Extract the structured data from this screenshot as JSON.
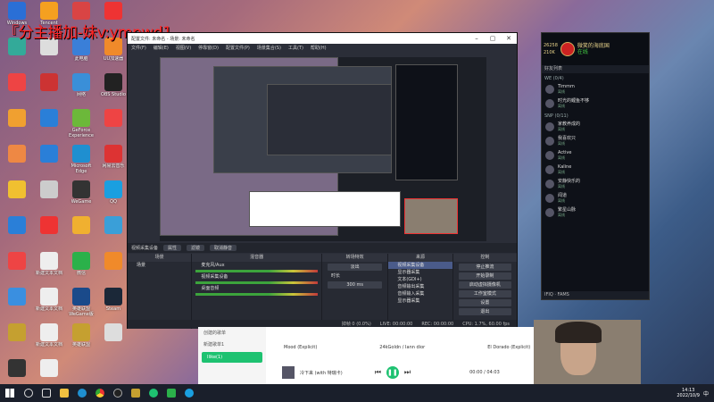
{
  "watermark": "『分主播加-妹v:ympwd1",
  "desktop_icons": [
    {
      "label": "Windows",
      "color": "#2a6fd6"
    },
    {
      "label": "Tencent",
      "color": "#f5a020"
    },
    {
      "label": "",
      "color": "#d94444"
    },
    {
      "label": "",
      "color": "#e33"
    },
    {
      "label": "",
      "color": "#3a9"
    },
    {
      "label": "",
      "color": "#ddd"
    },
    {
      "label": "此电脑",
      "color": "#3a7fd8"
    },
    {
      "label": "UU加速器",
      "color": "#f08a2a"
    },
    {
      "label": "",
      "color": "#e44"
    },
    {
      "label": "",
      "color": "#c33"
    },
    {
      "label": "网络",
      "color": "#3a8fd8"
    },
    {
      "label": "OBS Studio",
      "color": "#222"
    },
    {
      "label": "",
      "color": "#f0a030"
    },
    {
      "label": "",
      "color": "#2a7fd8"
    },
    {
      "label": "GeForce Experience",
      "color": "#6cb83a"
    },
    {
      "label": "",
      "color": "#e44"
    },
    {
      "label": "",
      "color": "#e84"
    },
    {
      "label": "",
      "color": "#2a7fd8"
    },
    {
      "label": "Microsoft Edge",
      "color": "#1f8fd0"
    },
    {
      "label": "网易云音乐",
      "color": "#d33"
    },
    {
      "label": "",
      "color": "#f0c030"
    },
    {
      "label": "",
      "color": "#ccc"
    },
    {
      "label": "WeGame",
      "color": "#333"
    },
    {
      "label": "QQ",
      "color": "#1a9fe0"
    },
    {
      "label": "",
      "color": "#2a7fd8"
    },
    {
      "label": "",
      "color": "#e33"
    },
    {
      "label": "",
      "color": "#f0b030"
    },
    {
      "label": "",
      "color": "#3a9fd8"
    },
    {
      "label": "",
      "color": "#e44"
    },
    {
      "label": "新建文本文档",
      "color": "#eee"
    },
    {
      "label": "微信",
      "color": "#2bb14a"
    },
    {
      "label": "",
      "color": "#f08a2a"
    },
    {
      "label": "",
      "color": "#3a8fe0"
    },
    {
      "label": "新建文本文档",
      "color": "#eee"
    },
    {
      "label": "英雄联盟WeGame版",
      "color": "#1a4a8a"
    },
    {
      "label": "Steam",
      "color": "#1b2838"
    },
    {
      "label": "",
      "color": "#c5a030"
    },
    {
      "label": "新建文本文档",
      "color": "#eee"
    },
    {
      "label": "英雄联盟",
      "color": "#c5a030"
    },
    {
      "label": "",
      "color": "#ddd"
    },
    {
      "label": "",
      "color": "#333"
    },
    {
      "label": "",
      "color": "#eee"
    }
  ],
  "obs": {
    "title": "配置文件: 未命名 - 场景: 未命名",
    "menu": [
      "文件(F)",
      "编辑(E)",
      "视图(V)",
      "停靠窗(D)",
      "配置文件(P)",
      "场景集合(S)",
      "工具(T)",
      "帮助(H)"
    ],
    "scene_label": "视频采集设备",
    "scene_buttons": [
      "属性",
      "滤镜",
      "取消静音"
    ],
    "docks": {
      "scenes": {
        "header": "场景",
        "items": [
          "场景"
        ]
      },
      "mixer": {
        "header": "混音器",
        "channels": [
          {
            "name": "麦克风/Aux",
            "db": "0.0 dB"
          },
          {
            "name": "视频采集设备",
            "db": "0.0 dB"
          },
          {
            "name": "桌面音频",
            "db": "0.0 dB"
          }
        ]
      },
      "transitions": {
        "header": "转场特效",
        "fade": "淡出",
        "duration_label": "时长",
        "duration_value": "300 ms"
      },
      "sources": {
        "header": "来源",
        "items": [
          "视频采集设备",
          "显示器采集",
          "文本(GDI+)",
          "音频输出采集",
          "音频输入采集",
          "显示器采集"
        ]
      },
      "controls": {
        "header": "控制",
        "buttons": [
          "停止推流",
          "开始录制",
          "启动虚拟摄像机",
          "工作室模式",
          "设置",
          "退出"
        ]
      }
    },
    "status": {
      "live": "LIVE: 00:00:00",
      "rec": "REC: 00:00:00",
      "cpu": "CPU: 1.7%, 60.00 fps",
      "dropped": "掉帧 0 (0.0%)"
    }
  },
  "friends": {
    "coins": "26258",
    "rp": "210K",
    "username": "微笑的海底国",
    "status": "在线",
    "header": "好友列表",
    "group1": "WE (0/4)",
    "group2": "SNP (0/11)",
    "items": [
      {
        "name": "Timmm",
        "status": "离线"
      },
      {
        "name": "时光的鲤鱼不够",
        "status": "离线"
      },
      {
        "name": "家教养成的",
        "status": "离线"
      },
      {
        "name": "我喜欢只",
        "status": "离线"
      },
      {
        "name": "Active",
        "status": "离线"
      },
      {
        "name": "Kaline",
        "status": "离线"
      },
      {
        "name": "安静快乐的",
        "status": "离线"
      },
      {
        "name": "闻道",
        "status": "离线"
      },
      {
        "name": "繁星山脉",
        "status": "离线"
      }
    ],
    "footer": "IFIQ · FAMS"
  },
  "music": {
    "sidebar": [
      "创建的歌单",
      "新建歌单1",
      "Ilike(1)"
    ],
    "tracks": [
      {
        "title": "Mood (Explicit)",
        "artist": "24kGoldn / Iann dior",
        "album": "El Dorado (Explicit)"
      }
    ],
    "now_playing": "冷下来 (with 特瑞卡)",
    "time": "00:00 / 04:03",
    "accent": "#1ec271"
  },
  "taskbar": {
    "time": "14:13",
    "date": "2022/10/9",
    "lang": "中"
  }
}
